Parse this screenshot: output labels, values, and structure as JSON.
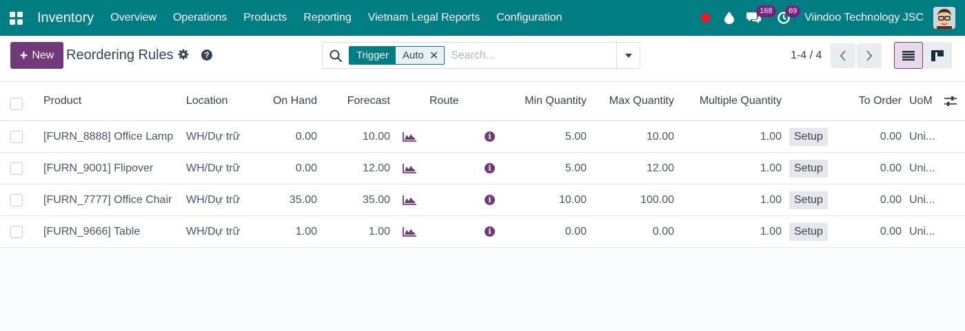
{
  "navbar": {
    "app_name": "Inventory",
    "menu": [
      "Overview",
      "Operations",
      "Products",
      "Reporting",
      "Vietnam Legal Reports",
      "Configuration"
    ],
    "messages_count": "168",
    "activities_count": "69",
    "company": "Viindoo Technology JSC",
    "colors": {
      "bg": "#017e84",
      "badge": "#7b1e7c",
      "record": "#e11d2d"
    }
  },
  "control": {
    "new_label": "New",
    "title": "Reordering Rules",
    "facet": {
      "label": "Trigger",
      "value": "Auto"
    },
    "search_placeholder": "Search...",
    "pager": "1-4 / 4"
  },
  "table": {
    "headers": {
      "product": "Product",
      "location": "Location",
      "on_hand": "On Hand",
      "forecast": "Forecast",
      "route": "Route",
      "min_qty": "Min Quantity",
      "max_qty": "Max Quantity",
      "multiple_qty": "Multiple Quantity",
      "to_order": "To Order",
      "uom": "UoM"
    },
    "rows": [
      {
        "product": "[FURN_8888] Office Lamp",
        "location": "WH/Dự trữ",
        "on_hand": "0.00",
        "forecast": "10.00",
        "min_qty": "5.00",
        "max_qty": "10.00",
        "multiple_qty": "1.00",
        "setup": "Setup",
        "to_order": "0.00",
        "uom": "Uni..."
      },
      {
        "product": "[FURN_9001] Flipover",
        "location": "WH/Dự trữ",
        "on_hand": "0.00",
        "forecast": "12.00",
        "min_qty": "5.00",
        "max_qty": "12.00",
        "multiple_qty": "1.00",
        "setup": "Setup",
        "to_order": "0.00",
        "uom": "Uni..."
      },
      {
        "product": "[FURN_7777] Office Chair",
        "location": "WH/Dự trữ",
        "on_hand": "35.00",
        "forecast": "35.00",
        "min_qty": "10.00",
        "max_qty": "100.00",
        "multiple_qty": "1.00",
        "setup": "Setup",
        "to_order": "0.00",
        "uom": "Uni..."
      },
      {
        "product": "[FURN_9666] Table",
        "location": "WH/Dự trữ",
        "on_hand": "1.00",
        "forecast": "1.00",
        "min_qty": "0.00",
        "max_qty": "0.00",
        "multiple_qty": "1.00",
        "setup": "Setup",
        "to_order": "0.00",
        "uom": "Uni..."
      }
    ],
    "icons": {
      "forecast": "area-chart-icon",
      "route": "info-circle-icon"
    },
    "accent": "#71387a"
  }
}
